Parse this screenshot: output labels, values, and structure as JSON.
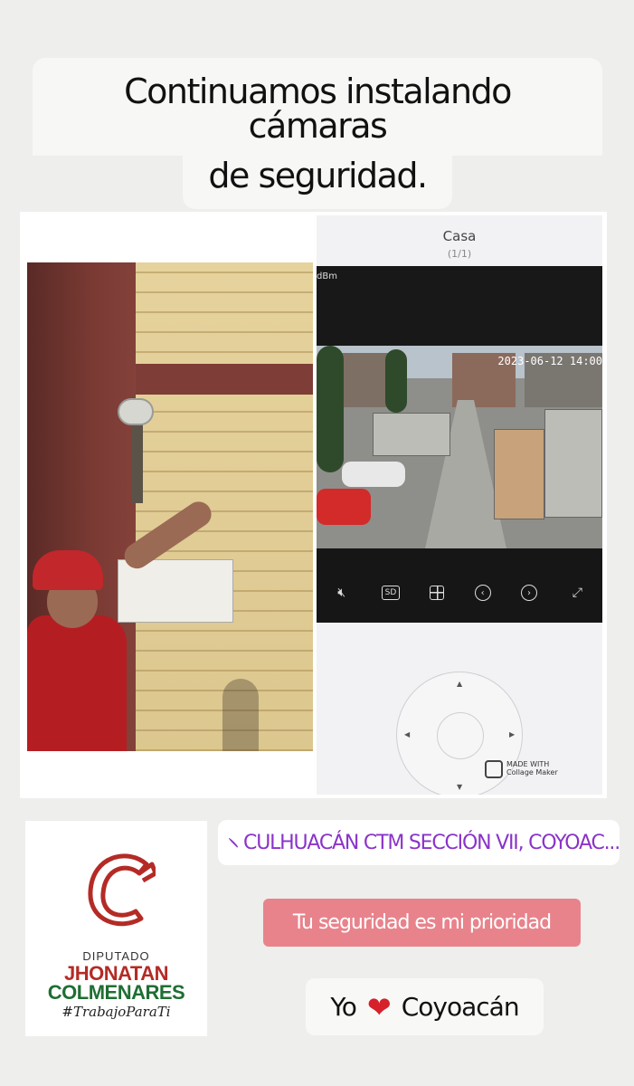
{
  "caption": {
    "line1": "Continuamos instalando cámaras",
    "line2": "de seguridad."
  },
  "phone_screen": {
    "title": "Casa",
    "subtitle": "(1/1)",
    "signal": "dBm",
    "timestamp": "2023-06-12 14:00",
    "controls": [
      "mute-icon",
      "SD",
      "grid-icon",
      "prev-icon",
      "next-icon",
      "fullscreen-icon"
    ],
    "sd_label": "SD",
    "watermark_line1": "MADE WITH",
    "watermark_line2": "Collage Maker"
  },
  "logo": {
    "title": "DIPUTADO",
    "first_name": "JHONATAN",
    "last_name": "COLMENARES",
    "hashtag": "#TrabajoParaTi",
    "colors": {
      "red": "#b42b26",
      "green": "#1f6e33"
    }
  },
  "location": {
    "icon": "location-pin-icon",
    "text": "CULHUACÁN CTM SECCIÓN VII, COYOAC...",
    "color": "#8a33c9"
  },
  "slogan": {
    "text": "Tu seguridad es mi prioridad",
    "color": "#e8838c"
  },
  "love_sticker": {
    "left": "Yo",
    "heart": "❤",
    "right": "Coyoacán"
  }
}
